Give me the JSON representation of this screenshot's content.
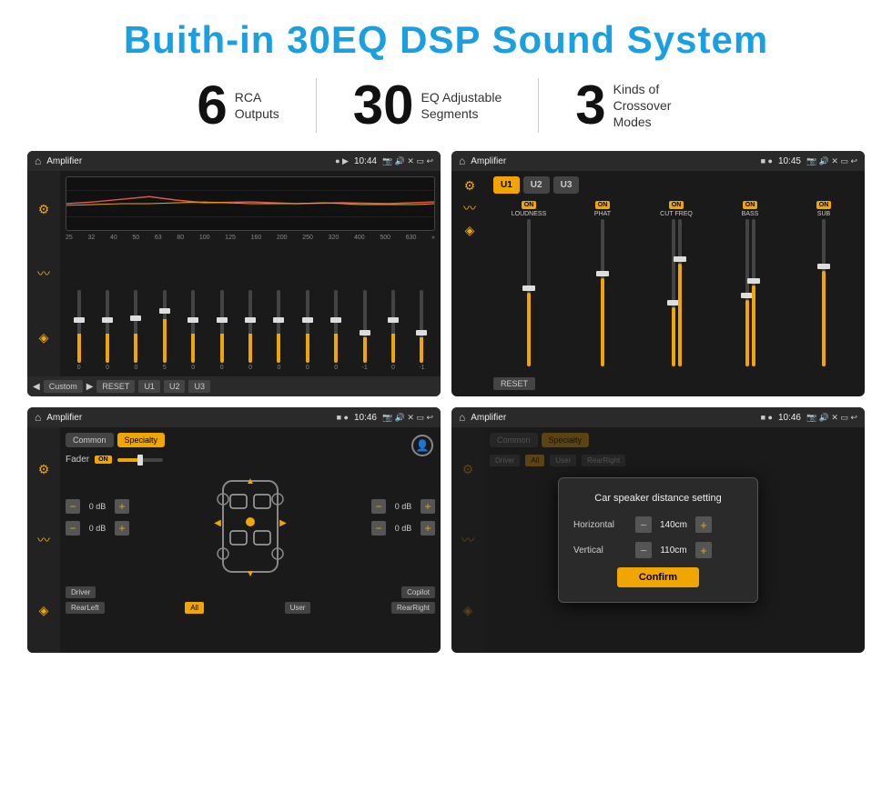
{
  "page": {
    "title": "Buith-in 30EQ DSP Sound System"
  },
  "stats": [
    {
      "number": "6",
      "label": "RCA\nOutputs"
    },
    {
      "number": "30",
      "label": "EQ Adjustable\nSegments"
    },
    {
      "number": "3",
      "label": "Kinds of\nCrossover Modes"
    }
  ],
  "screens": [
    {
      "id": "eq-screen",
      "topbar": {
        "title": "Amplifier",
        "time": "10:44"
      },
      "type": "eq"
    },
    {
      "id": "crossover-screen",
      "topbar": {
        "title": "Amplifier",
        "time": "10:45"
      },
      "type": "crossover"
    },
    {
      "id": "fader-screen",
      "topbar": {
        "title": "Amplifier",
        "time": "10:46"
      },
      "type": "fader"
    },
    {
      "id": "distance-screen",
      "topbar": {
        "title": "Amplifier",
        "time": "10:46"
      },
      "type": "distance"
    }
  ],
  "eq": {
    "freqs": [
      "25",
      "32",
      "40",
      "50",
      "63",
      "80",
      "100",
      "125",
      "160",
      "200",
      "250",
      "320",
      "400",
      "500",
      "630"
    ],
    "values": [
      "0",
      "0",
      "0",
      "5",
      "0",
      "0",
      "0",
      "0",
      "0",
      "0",
      "-1",
      "0",
      "-1"
    ],
    "buttons": {
      "custom": "Custom",
      "reset": "RESET",
      "u1": "U1",
      "u2": "U2",
      "u3": "U3"
    }
  },
  "crossover": {
    "uButtons": [
      "U1",
      "U2",
      "U3"
    ],
    "channels": [
      {
        "label": "LOUDNESS",
        "on": true
      },
      {
        "label": "PHAT",
        "on": true
      },
      {
        "label": "CUT FREQ",
        "on": true
      },
      {
        "label": "BASS",
        "on": true
      },
      {
        "label": "SUB",
        "on": true
      }
    ],
    "resetLabel": "RESET"
  },
  "fader": {
    "tabs": [
      "Common",
      "Specialty"
    ],
    "faderLabel": "Fader",
    "onLabel": "ON",
    "volumes": {
      "frontLeft": "0 dB",
      "frontRight": "0 dB",
      "rearLeft": "0 dB",
      "rearRight": "0 dB"
    },
    "bottomButtons": [
      "Driver",
      "",
      "",
      "",
      "Copilot"
    ],
    "bottomRowBtns": [
      "RearLeft",
      "All",
      "User",
      "RearRight"
    ]
  },
  "dialog": {
    "title": "Car speaker distance setting",
    "horizontal": {
      "label": "Horizontal",
      "value": "140cm"
    },
    "vertical": {
      "label": "Vertical",
      "value": "110cm"
    },
    "confirmLabel": "Confirm"
  }
}
